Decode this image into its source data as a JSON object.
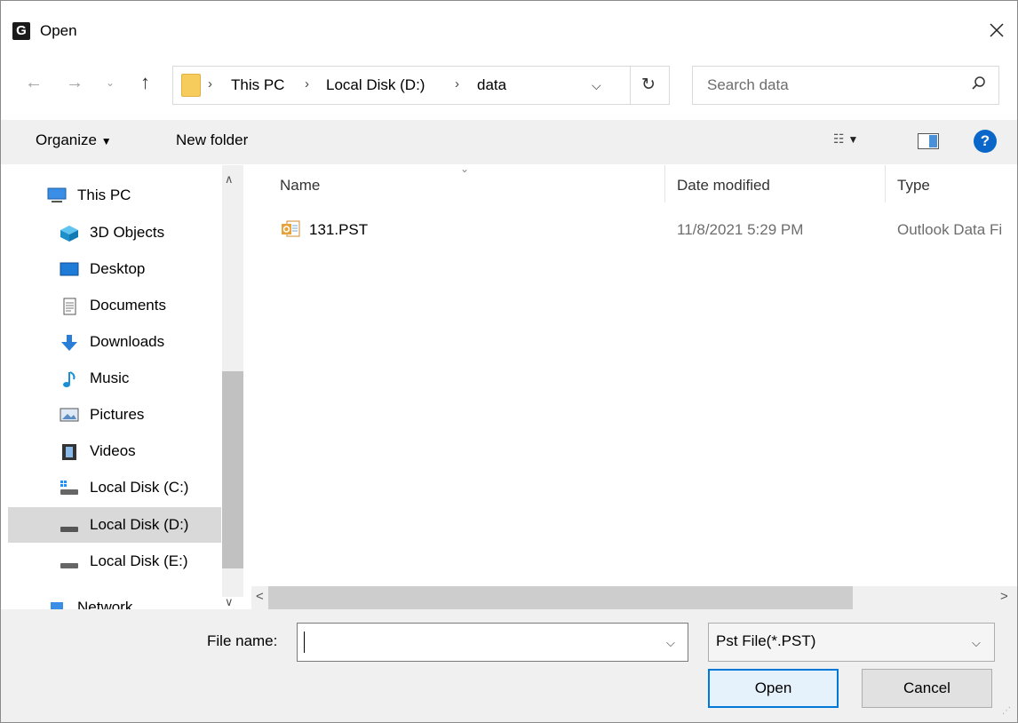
{
  "window": {
    "title": "Open",
    "app_icon_letter": "G"
  },
  "nav": {
    "breadcrumbs": [
      "This PC",
      "Local Disk (D:)",
      "data"
    ],
    "search_placeholder": "Search data"
  },
  "toolbar": {
    "organize_label": "Organize",
    "new_folder_label": "New folder"
  },
  "sidebar": {
    "items": [
      {
        "label": "This PC",
        "icon": "computer-icon",
        "selected": false
      },
      {
        "label": "3D Objects",
        "icon": "cube-icon",
        "selected": false
      },
      {
        "label": "Desktop",
        "icon": "desktop-icon",
        "selected": false
      },
      {
        "label": "Documents",
        "icon": "document-icon",
        "selected": false
      },
      {
        "label": "Downloads",
        "icon": "download-arrow-icon",
        "selected": false
      },
      {
        "label": "Music",
        "icon": "music-note-icon",
        "selected": false
      },
      {
        "label": "Pictures",
        "icon": "picture-icon",
        "selected": false
      },
      {
        "label": "Videos",
        "icon": "film-icon",
        "selected": false
      },
      {
        "label": "Local Disk (C:)",
        "icon": "drive-icon",
        "selected": false
      },
      {
        "label": "Local Disk (D:)",
        "icon": "drive-icon",
        "selected": true
      },
      {
        "label": "Local Disk (E:)",
        "icon": "drive-icon",
        "selected": false
      },
      {
        "label": "Network",
        "icon": "network-icon",
        "selected": false
      }
    ]
  },
  "content": {
    "columns": {
      "name": "Name",
      "date": "Date modified",
      "type": "Type"
    },
    "files": [
      {
        "name": "131.PST",
        "date_modified": "11/8/2021 5:29 PM",
        "type": "Outlook Data Fi"
      }
    ]
  },
  "footer": {
    "file_name_label": "File name:",
    "file_name_value": "",
    "file_type_value": "Pst File(*.PST)",
    "open_label": "Open",
    "cancel_label": "Cancel"
  },
  "colors": {
    "accent": "#0078d7",
    "help": "#0a66c8",
    "folder": "#f6cc5d",
    "toolbar_bg": "#f0f0f0",
    "selected_bg": "#d9d9d9"
  }
}
